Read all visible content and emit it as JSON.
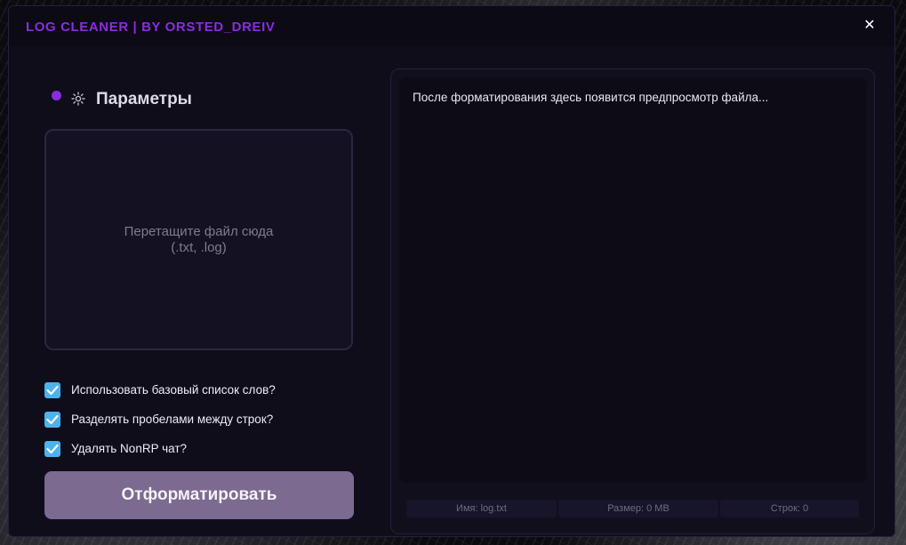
{
  "window": {
    "title": "LOG CLEANER | BY ORSTED_DREIV",
    "close_label": "✕"
  },
  "params": {
    "title": "Параметры",
    "icon": "gear-icon"
  },
  "dropzone": {
    "line1": "Перетащите файл сюда",
    "line2": "(.txt, .log)"
  },
  "options": [
    {
      "label": "Использовать базовый список слов?",
      "checked": true
    },
    {
      "label": "Разделять пробелами между строк?",
      "checked": true
    },
    {
      "label": "Удалять NonRP чат?",
      "checked": true
    }
  ],
  "format_button": {
    "label": "Отформатировать"
  },
  "preview": {
    "placeholder": "После форматирования здесь появится предпросмотр файла..."
  },
  "status": {
    "name": "Имя: log.txt",
    "size": "Размер: 0 MB",
    "lines": "Строк: 0"
  },
  "colors": {
    "accent": "#8a2ce0",
    "checkbox": "#4db3ee",
    "button": "#7c6a90",
    "window_bg": "#0f0d19"
  }
}
